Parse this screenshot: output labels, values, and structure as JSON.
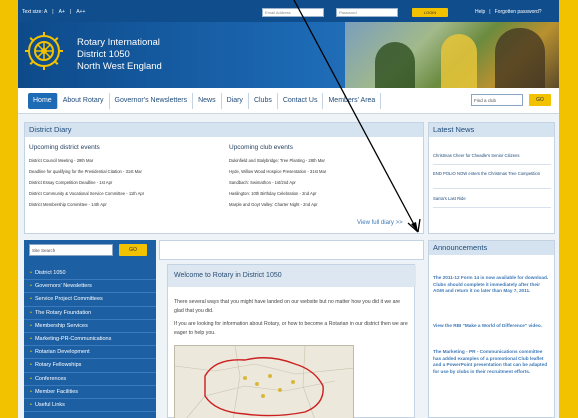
{
  "topbar": {
    "text_size_label": "Text size: A",
    "text_size_plus": "A+",
    "text_size_plus2": "A++",
    "email_placeholder": "Email Address",
    "password_placeholder": "Password",
    "login_label": "LOGIN",
    "help_link": "Help",
    "forgotten_link": "Forgotten password?"
  },
  "header": {
    "line1": "Rotary International",
    "line2": "District 1050",
    "line3": "North West England"
  },
  "nav": {
    "items": [
      "Home",
      "About Rotary",
      "Governor's Newsletters",
      "News",
      "Diary",
      "Clubs",
      "Contact Us",
      "Members' Area"
    ],
    "find_placeholder": "Find a club",
    "go_label": "GO"
  },
  "diary": {
    "title": "District Diary",
    "district_heading": "Upcoming district events",
    "district_events": [
      "District Council Meeting - 29th Mar",
      "Deadline for qualifying for the Presidential Citation - 31st Mar",
      "District Essay Competition Deadline - 1st Apr",
      "District Community & Vocational Service Committee - 11th Apr",
      "District Membership Committee - 14th Apr"
    ],
    "club_heading": "Upcoming club events",
    "club_events": [
      "Dukinfield and Stalybridge: Tree Planting - 28th Mar",
      "Hyde, Willow Wood Hospice Presentation - 31st Mar",
      "Sandbach: Swimathon - 1st/2nd Apr",
      "Haslington: 10th Birthday Celebration - 2nd Apr",
      "Marple and Goyt Valley: Charter Night - 2nd Apr"
    ],
    "view_all": "View full diary >>"
  },
  "news": {
    "title": "Latest News",
    "items": [
      "Christmas Cheer for Cheadle's Senior Citizens",
      "END POLIO NOW enters the Christmas Tree Competition",
      "Santa's Last Ride"
    ]
  },
  "sidebar": {
    "search_placeholder": "Site Search",
    "go_label": "GO",
    "menu": [
      "District 1050",
      "Governors' Newsletters",
      "Service Project Committees",
      "The Rotary Foundation",
      "Membership Services",
      "Marketing-PR-Communications",
      "Rotarian Development",
      "Rotary Fellowships",
      "Conferences",
      "Member Facilities",
      "Useful Links"
    ]
  },
  "welcome": {
    "title": "Welcome to Rotary in District 1050",
    "para1": "There several ways that you might have landed on our website but no matter how you did it we are glad that you did.",
    "para2": "If you are looking for information about Rotary, or how to become a Rotarian in our district then we are eager to help you."
  },
  "announcements": {
    "title": "Announcements",
    "items": [
      "The 2011-12 Form 14 is now available for download. Clubs should complete it immediately after their AGM and return it no later than May 7, 2011.",
      "View the RBI \"Make a World of Difference\" video.",
      "The Marketing - PR - Communications committee has added examples of a promotional Club leaflet and a PowerPoint presentation that can be adapted for use by clubs in their recruitment efforts."
    ]
  },
  "colors": {
    "brand_blue": "#1d5fa3",
    "gold": "#f2c200",
    "link_blue": "#3d79b8"
  }
}
